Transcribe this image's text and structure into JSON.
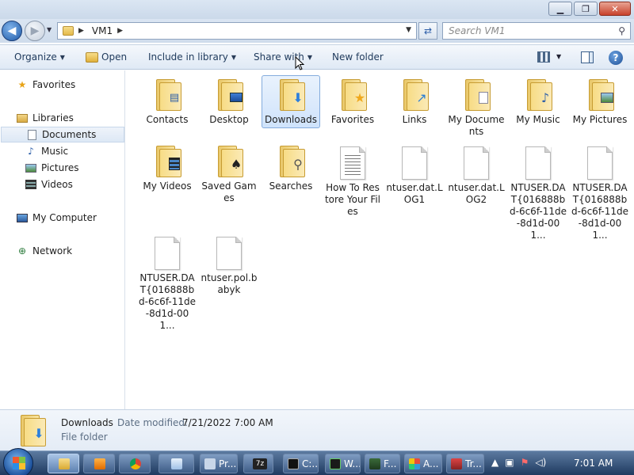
{
  "address": {
    "crumb": "VM1"
  },
  "search": {
    "placeholder": "Search VM1"
  },
  "toolbar": {
    "organize": "Organize",
    "open": "Open",
    "include_in_library": "Include in library",
    "share_with": "Share with",
    "new_folder": "New folder"
  },
  "nav": {
    "favorites": "Favorites",
    "libraries": "Libraries",
    "documents": "Documents",
    "music": "Music",
    "pictures": "Pictures",
    "videos": "Videos",
    "my_computer": "My Computer",
    "network": "Network"
  },
  "items": [
    {
      "label": "Contacts",
      "kind": "folder"
    },
    {
      "label": "Desktop",
      "kind": "folder"
    },
    {
      "label": "Downloads",
      "kind": "folder",
      "selected": true
    },
    {
      "label": "Favorites",
      "kind": "folder"
    },
    {
      "label": "Links",
      "kind": "folder"
    },
    {
      "label": "My Documents",
      "kind": "folder"
    },
    {
      "label": "My Music",
      "kind": "folder"
    },
    {
      "label": "My Pictures",
      "kind": "folder"
    },
    {
      "label": "My Videos",
      "kind": "folder"
    },
    {
      "label": "Saved Games",
      "kind": "folder"
    },
    {
      "label": "Searches",
      "kind": "folder"
    },
    {
      "label": "How To Restore Your Files",
      "kind": "text"
    },
    {
      "label": "ntuser.dat.LOG1",
      "kind": "file"
    },
    {
      "label": "ntuser.dat.LOG2",
      "kind": "file"
    },
    {
      "label": "NTUSER.DAT{016888bd-6c6f-11de-8d1d-001...",
      "kind": "file"
    },
    {
      "label": "NTUSER.DAT{016888bd-6c6f-11de-8d1d-001...",
      "kind": "file"
    },
    {
      "label": "NTUSER.DAT{016888bd-6c6f-11de-8d1d-001...",
      "kind": "file"
    },
    {
      "label": "ntuser.pol.babyk",
      "kind": "file"
    }
  ],
  "details": {
    "name": "Downloads",
    "date_key": "Date modified:",
    "date_value": "7/21/2022 7:00 AM",
    "type": "File folder"
  },
  "taskbar": {
    "btn_pr": "Pr...",
    "btn_c": "C:...",
    "btn_w": "W...",
    "btn_f": "F...",
    "btn_a": "A...",
    "btn_tr": "Tr...",
    "clock": "7:01 AM"
  }
}
